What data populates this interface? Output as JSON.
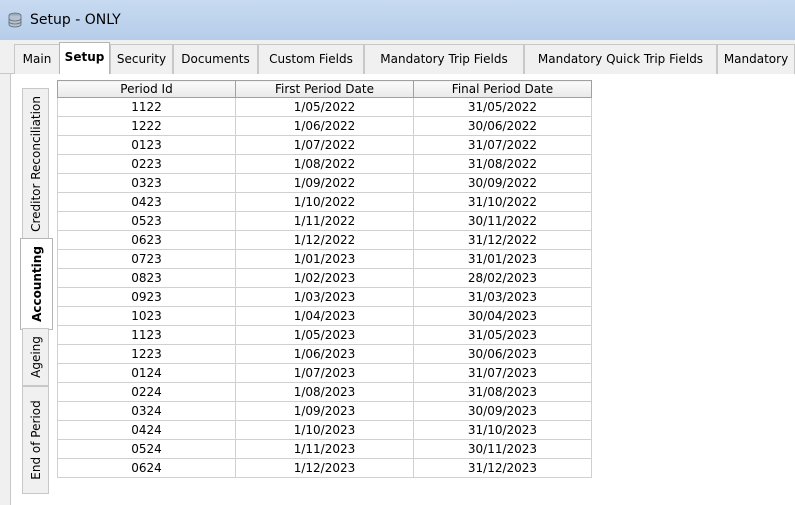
{
  "window": {
    "title": "Setup - ONLY",
    "icon": "database-icon"
  },
  "tabs": [
    {
      "label": "Main",
      "active": false
    },
    {
      "label": "Setup",
      "active": true
    },
    {
      "label": "Security",
      "active": false
    },
    {
      "label": "Documents",
      "active": false
    },
    {
      "label": "Custom Fields",
      "active": false
    },
    {
      "label": "Mandatory Trip Fields",
      "active": false
    },
    {
      "label": "Mandatory Quick Trip Fields",
      "active": false
    },
    {
      "label": "Mandatory",
      "active": false
    }
  ],
  "side_tabs": [
    {
      "label": "Creditor Reconciliation",
      "active": false
    },
    {
      "label": "Accounting",
      "active": true
    },
    {
      "label": "Ageing",
      "active": false
    },
    {
      "label": "End of Period",
      "active": false
    }
  ],
  "grid": {
    "columns": [
      "Period Id",
      "First Period Date",
      "Final Period Date"
    ],
    "rows": [
      [
        "1122",
        "1/05/2022",
        "31/05/2022"
      ],
      [
        "1222",
        "1/06/2022",
        "30/06/2022"
      ],
      [
        "0123",
        "1/07/2022",
        "31/07/2022"
      ],
      [
        "0223",
        "1/08/2022",
        "31/08/2022"
      ],
      [
        "0323",
        "1/09/2022",
        "30/09/2022"
      ],
      [
        "0423",
        "1/10/2022",
        "31/10/2022"
      ],
      [
        "0523",
        "1/11/2022",
        "30/11/2022"
      ],
      [
        "0623",
        "1/12/2022",
        "31/12/2022"
      ],
      [
        "0723",
        "1/01/2023",
        "31/01/2023"
      ],
      [
        "0823",
        "1/02/2023",
        "28/02/2023"
      ],
      [
        "0923",
        "1/03/2023",
        "31/03/2023"
      ],
      [
        "1023",
        "1/04/2023",
        "30/04/2023"
      ],
      [
        "1123",
        "1/05/2023",
        "31/05/2023"
      ],
      [
        "1223",
        "1/06/2023",
        "30/06/2023"
      ],
      [
        "0124",
        "1/07/2023",
        "31/07/2023"
      ],
      [
        "0224",
        "1/08/2023",
        "31/08/2023"
      ],
      [
        "0324",
        "1/09/2023",
        "30/09/2023"
      ],
      [
        "0424",
        "1/10/2023",
        "31/10/2023"
      ],
      [
        "0524",
        "1/11/2023",
        "30/11/2023"
      ],
      [
        "0624",
        "1/12/2023",
        "31/12/2023"
      ]
    ]
  }
}
